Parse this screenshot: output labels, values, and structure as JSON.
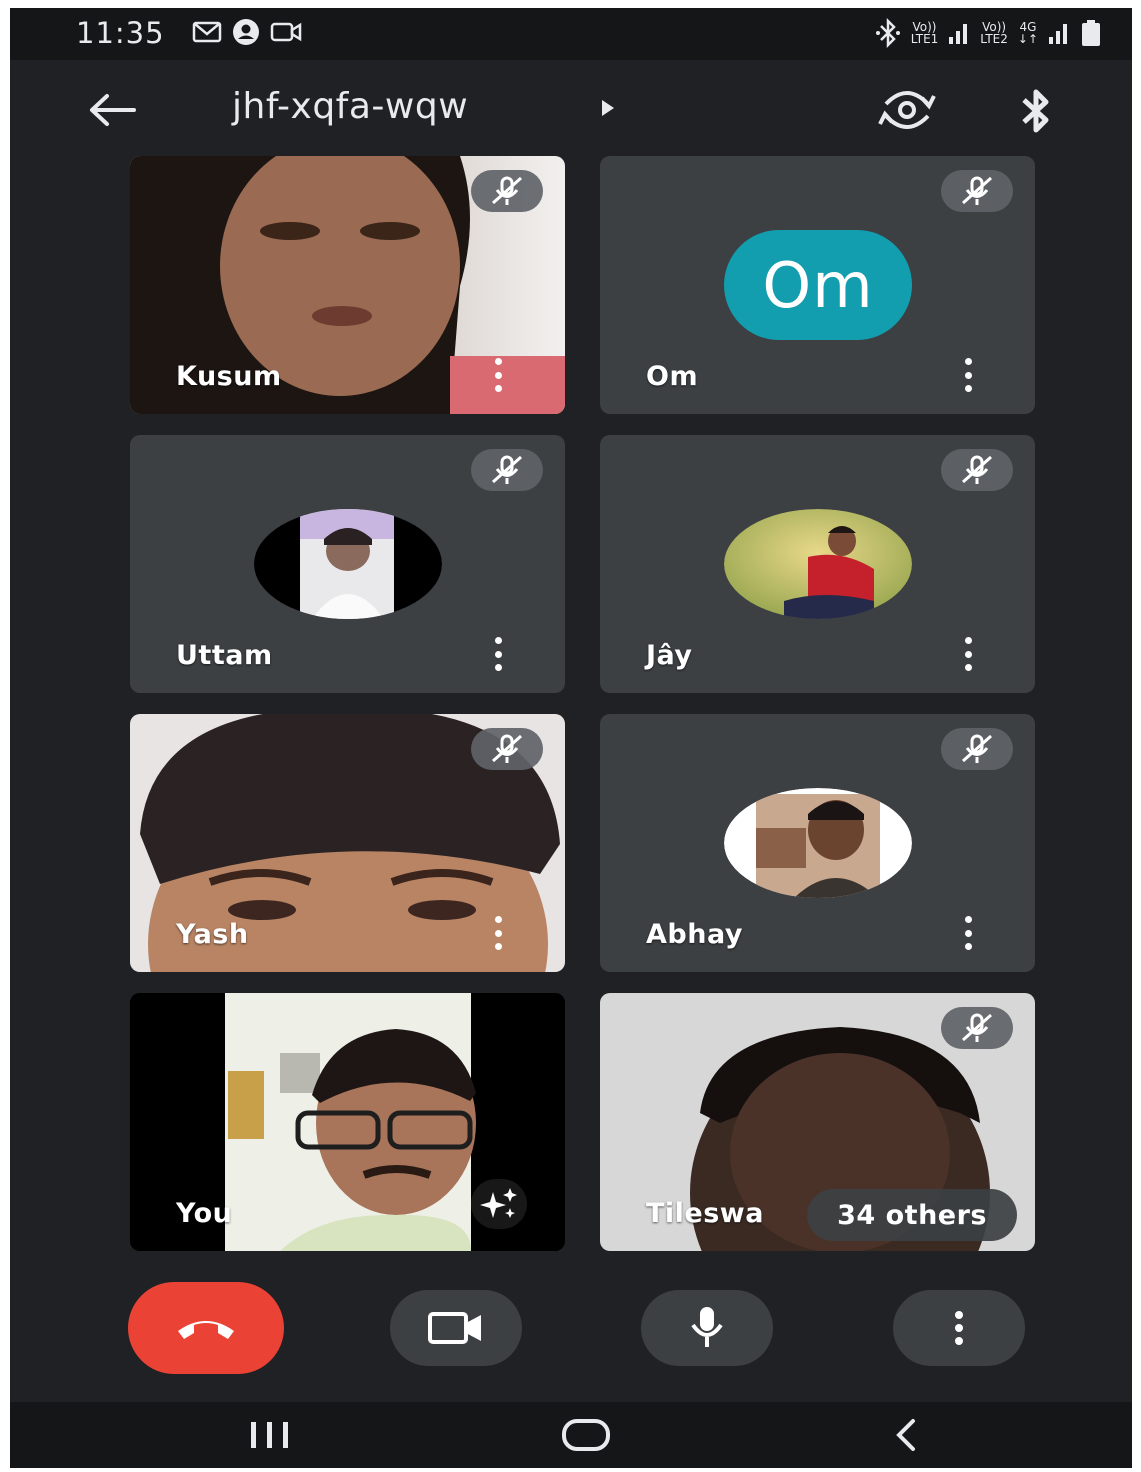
{
  "status_bar": {
    "time": "11:35",
    "left_icons": [
      "gmail-icon",
      "account-icon",
      "video-icon"
    ],
    "right_icons": [
      "bluetooth-icon",
      "sim1-signal-icon",
      "sim2-signal-icon",
      "battery-icon"
    ],
    "sim1_label_top": "Vo))",
    "sim1_label_bottom": "LTE1",
    "sim2_label_top": "Vo))",
    "sim2_label_bottom": "LTE2",
    "network_top": "4G",
    "network_bottom": "↓↑"
  },
  "top_bar": {
    "meeting_code": "jhf-xqfa-wqw",
    "icons": [
      "back-arrow-icon",
      "play-arrow-icon",
      "switch-camera-icon",
      "bluetooth-icon"
    ]
  },
  "participants": [
    {
      "name": "Kusum",
      "muted": true,
      "type": "video"
    },
    {
      "name": "Om",
      "muted": true,
      "type": "initials",
      "initials": "Om",
      "avatar_color": "#129eaf"
    },
    {
      "name": "Uttam",
      "muted": true,
      "type": "avatar"
    },
    {
      "name": "Jây",
      "muted": true,
      "type": "avatar"
    },
    {
      "name": "Yash",
      "muted": true,
      "type": "video"
    },
    {
      "name": "Abhay",
      "muted": true,
      "type": "avatar"
    },
    {
      "name": "You",
      "muted": false,
      "type": "video"
    },
    {
      "name": "Tileswa",
      "muted": true,
      "type": "video",
      "overflow_label": "34 others"
    }
  ],
  "controls": {
    "icons": [
      "end-call-icon",
      "camera-icon",
      "microphone-icon",
      "more-options-icon"
    ],
    "end_call_color": "#ea4335"
  },
  "nav_bar": {
    "icons": [
      "recent-apps-icon",
      "home-icon",
      "back-icon"
    ]
  },
  "colors": {
    "background": "#202124",
    "tile": "#3c4043",
    "control": "#3c4043",
    "text": "#e8eaed"
  }
}
